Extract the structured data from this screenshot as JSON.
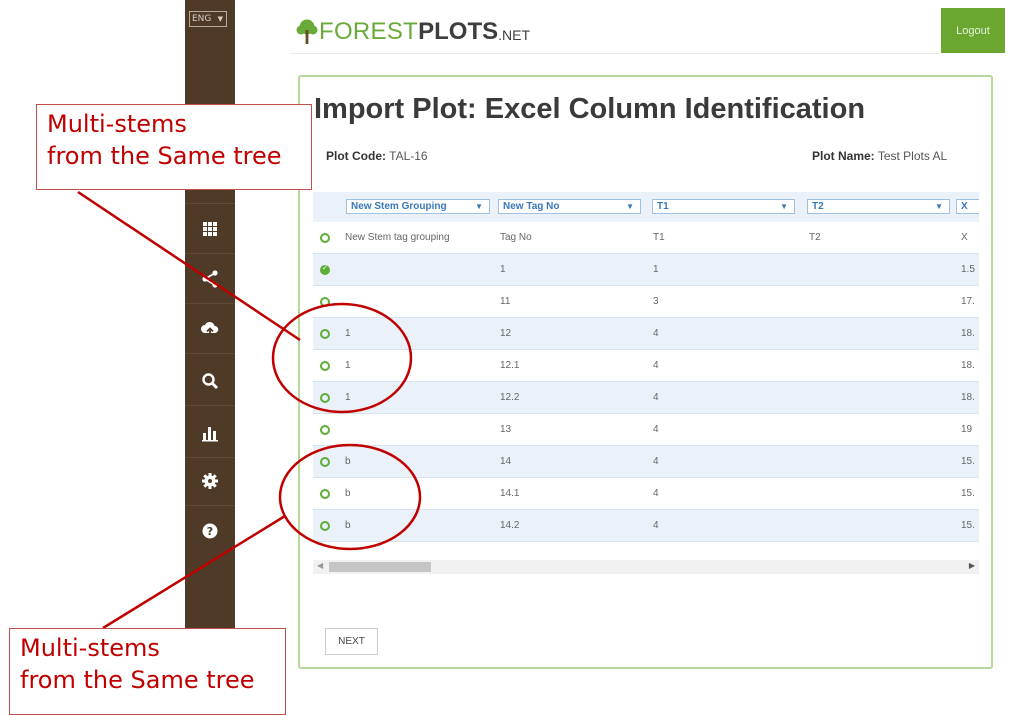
{
  "language": "ENG",
  "sidebar_icons": [
    "pencil-icon",
    "grid-icon",
    "share-icon",
    "cloud-upload-icon",
    "search-icon",
    "bar-chart-icon",
    "gear-icon",
    "help-icon"
  ],
  "header": {
    "logo_part1": "FOREST",
    "logo_part2": "PLOTS",
    "logo_part3": ".NET",
    "logout": "Logout"
  },
  "page": {
    "title": "Import Plot: Excel Column Identification",
    "plot_code_label": "Plot Code:",
    "plot_code": "TAL-16",
    "plot_name_label": "Plot Name:",
    "plot_name": "Test Plots AL"
  },
  "table": {
    "column_selects": [
      "New Stem Grouping",
      "New Tag No",
      "T1",
      "T2",
      "X"
    ],
    "rows": [
      {
        "selected": false,
        "grouping": "New Stem tag grouping",
        "tag": "Tag No",
        "t1": "T1",
        "t2": "T2",
        "x": "X"
      },
      {
        "selected": true,
        "grouping": "",
        "tag": "1",
        "t1": "1",
        "t2": "",
        "x": "1.5"
      },
      {
        "selected": false,
        "grouping": "",
        "tag": "11",
        "t1": "3",
        "t2": "",
        "x": "17."
      },
      {
        "selected": false,
        "grouping": "1",
        "tag": "12",
        "t1": "4",
        "t2": "",
        "x": "18."
      },
      {
        "selected": false,
        "grouping": "1",
        "tag": "12.1",
        "t1": "4",
        "t2": "",
        "x": "18."
      },
      {
        "selected": false,
        "grouping": "1",
        "tag": "12.2",
        "t1": "4",
        "t2": "",
        "x": "18."
      },
      {
        "selected": false,
        "grouping": "",
        "tag": "13",
        "t1": "4",
        "t2": "",
        "x": "19"
      },
      {
        "selected": false,
        "grouping": "b",
        "tag": "14",
        "t1": "4",
        "t2": "",
        "x": "15."
      },
      {
        "selected": false,
        "grouping": "b",
        "tag": "14.1",
        "t1": "4",
        "t2": "",
        "x": "15."
      },
      {
        "selected": false,
        "grouping": "b",
        "tag": "14.2",
        "t1": "4",
        "t2": "",
        "x": "15."
      }
    ]
  },
  "next_label": "NEXT",
  "annotations": {
    "top_line1": "Multi-stems",
    "top_line2": "from the Same tree",
    "bottom_line1": "Multi-stems",
    "bottom_line2": "from the Same tree"
  },
  "colors": {
    "sidebar": "#4f3a28",
    "accent_green": "#6ba631",
    "annotation_red": "#c00000",
    "row_alt": "#eaf1f8"
  }
}
